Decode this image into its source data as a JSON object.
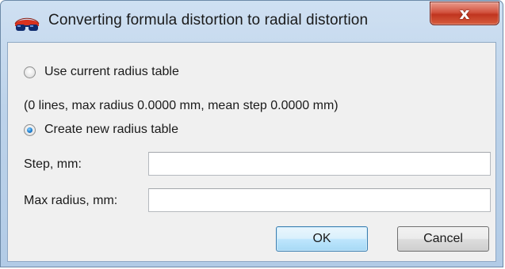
{
  "window": {
    "title": "Converting formula distortion to radial distortion",
    "close_label": "x",
    "icon": "red-glasses-app-icon"
  },
  "options": {
    "use_current": {
      "label": "Use current radius table",
      "checked": false
    },
    "current_info": "(0 lines, max radius 0.0000 mm, mean step 0.0000 mm)",
    "create_new": {
      "label": "Create new radius table",
      "checked": true
    }
  },
  "fields": {
    "step": {
      "label": "Step, mm:",
      "value": ""
    },
    "max_radius": {
      "label": "Max radius, mm:",
      "value": ""
    }
  },
  "buttons": {
    "ok": "OK",
    "cancel": "Cancel"
  },
  "colors": {
    "accent": "#1e7fd0",
    "close": "#c0351f",
    "frame": "#b9d1ea"
  }
}
